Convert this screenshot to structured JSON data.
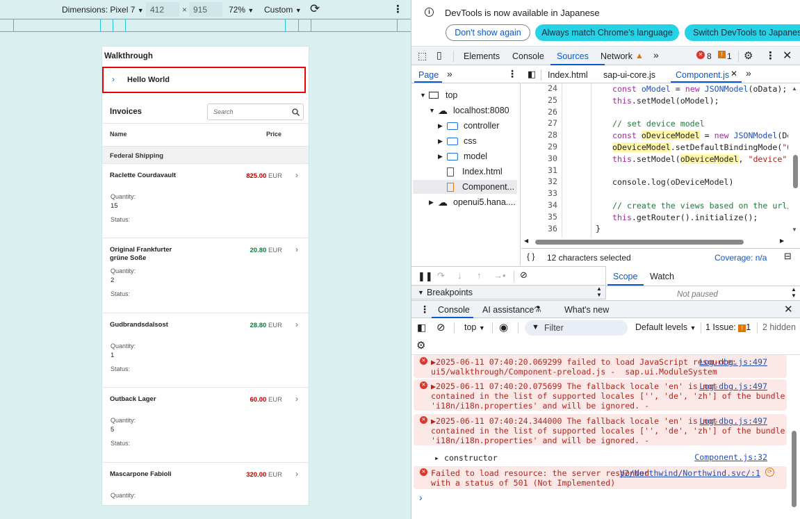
{
  "emulation": {
    "dimensions_label": "Dimensions: Pixel 7",
    "width": "412",
    "times": "×",
    "height": "915",
    "zoom": "72%",
    "throttle": "Custom"
  },
  "app": {
    "title": "Walkthrough",
    "hello_button": "Hello World",
    "invoices_title": "Invoices",
    "search_placeholder": "Search",
    "col_name": "Name",
    "col_price": "Price",
    "group_header": "Federal Shipping",
    "quantity_label": "Quantity:",
    "status_label": "Status:",
    "currency": "EUR",
    "items": [
      {
        "name": "Raclette Courdavault",
        "price": "825.00",
        "quantity": "15",
        "price_color": "#bb0000"
      },
      {
        "name": "Original Frankfurter grüne Soße",
        "price": "20.80",
        "quantity": "2",
        "price_color": "#107e3e"
      },
      {
        "name": "Gudbrandsdalsost",
        "price": "28.80",
        "quantity": "1",
        "price_color": "#107e3e"
      },
      {
        "name": "Outback Lager",
        "price": "60.00",
        "quantity": "5",
        "price_color": "#bb0000"
      },
      {
        "name": "Mascarpone Fabioli",
        "price": "320.00",
        "quantity": "",
        "price_color": "#bb0000"
      }
    ]
  },
  "devtools": {
    "banner_text": "DevTools is now available in Japanese",
    "banner_btn1": "Don't show again",
    "banner_btn2": "Always match Chrome's language",
    "banner_btn3": "Switch DevTools to Japanese",
    "tabs": [
      "Elements",
      "Console",
      "Sources",
      "Network"
    ],
    "error_count": "8",
    "warn_count": "1",
    "nav_tab": "Page",
    "tree": {
      "top": "top",
      "host": "localhost:8080",
      "f1": "controller",
      "f2": "css",
      "f3": "model",
      "file1": "Index.html",
      "file2": "Component...",
      "ext": "openui5.hana...."
    },
    "editor_tabs": [
      "Index.html",
      "sap-ui-core.js",
      "Component.js"
    ],
    "code_lines": [
      {
        "n": "24",
        "text": ""
      },
      {
        "n": "25",
        "text": ""
      },
      {
        "n": "26",
        "text": ""
      },
      {
        "n": "27",
        "text": ""
      },
      {
        "n": "28",
        "text": ""
      },
      {
        "n": "29",
        "text": ""
      },
      {
        "n": "30",
        "text": ""
      },
      {
        "n": "31",
        "text": ""
      },
      {
        "n": "32",
        "text": ""
      },
      {
        "n": "33",
        "text": ""
      },
      {
        "n": "34",
        "text": ""
      },
      {
        "n": "35",
        "text": ""
      },
      {
        "n": "36",
        "text": ""
      }
    ],
    "status_selected": "12 characters selected",
    "coverage": "Coverage: n/a",
    "scope_tab": "Scope",
    "watch_tab": "Watch",
    "breakpoints": "Breakpoints",
    "not_paused": "Not paused",
    "drawer_tabs": [
      "Console",
      "AI assistance",
      "What's new"
    ],
    "context": "top",
    "filter_placeholder": "Filter",
    "levels": "Default levels",
    "issues_label": "1 Issue:",
    "issues_count": "1",
    "hidden": "2 hidden",
    "logs": [
      {
        "l1": "▶2025-06-11 07:40:20.069299 failed to load JavaScript resource:",
        "l2": "ui5/walkthrough/Component-preload.js -  sap.ui.ModuleSystem",
        "l3": "",
        "link": "Log-dbg.js:497"
      },
      {
        "l1": "▶2025-06-11 07:40:20.075699 The fallback locale 'en' is not",
        "l2": "contained in the list of supported locales ['', 'de', 'zh'] of the bundle",
        "l3": "'i18n/i18n.properties' and will be ignored. -",
        "link": "Log-dbg.js:497"
      },
      {
        "l1": "▶2025-06-11 07:40:24.344000 The fallback locale 'en' is not",
        "l2": "contained in the list of supported locales ['', 'de', 'zh'] of the bundle",
        "l3": "'i18n/i18n.properties' and will be ignored. -",
        "link": "Log-dbg.js:497"
      }
    ],
    "constructor_text": "▸ constructor",
    "constructor_link": "Component.js:32",
    "fail_l1": "Failed to load resource: the server responded",
    "fail_l2": "with a status of 501 (Not Implemented)",
    "fail_link": "V2/Northwind/Northwind.svc/:1",
    "prompt": "›"
  }
}
